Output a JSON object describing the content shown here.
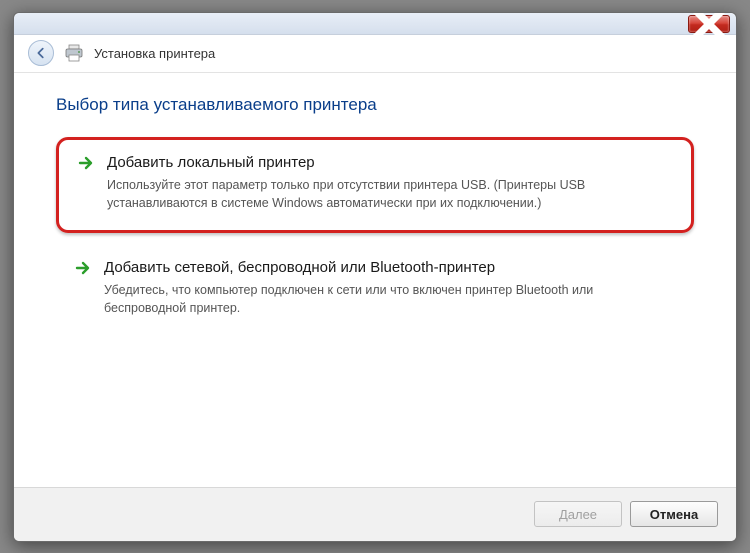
{
  "header": {
    "title": "Установка принтера"
  },
  "main": {
    "heading": "Выбор типа устанавливаемого принтера",
    "options": [
      {
        "title": "Добавить локальный принтер",
        "desc": "Используйте этот параметр только при отсутствии принтера USB. (Принтеры USB устанавливаются в системе Windows автоматически при их подключении.)"
      },
      {
        "title": "Добавить сетевой, беспроводной или Bluetooth-принтер",
        "desc": "Убедитесь, что компьютер подключен к сети или что включен принтер Bluetooth или беспроводной принтер."
      }
    ]
  },
  "footer": {
    "next": "Далее",
    "cancel": "Отмена"
  }
}
